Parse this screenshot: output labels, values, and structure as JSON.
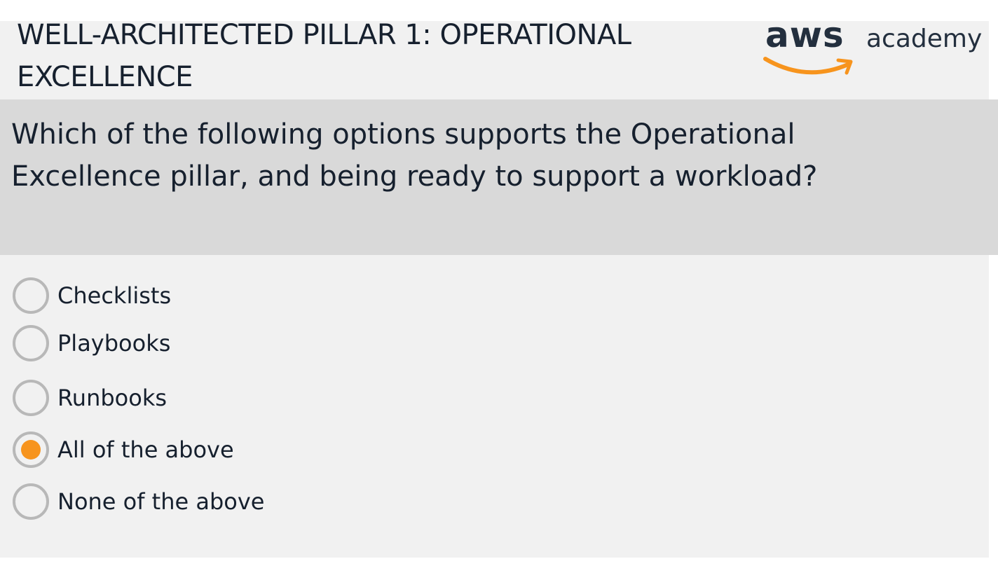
{
  "header": {
    "title": "WELL-ARCHITECTED PILLAR 1: OPERATIONAL EXCELLENCE",
    "logo_primary": "aws",
    "logo_secondary": "academy"
  },
  "question": {
    "text": "Which of the following options supports the Operational Excellence pillar, and being ready to support a workload?"
  },
  "options": [
    {
      "label": "Checklists",
      "selected": false
    },
    {
      "label": "Playbooks",
      "selected": false
    },
    {
      "label": "Runbooks",
      "selected": false
    },
    {
      "label": "All of the above",
      "selected": true
    },
    {
      "label": "None of the above",
      "selected": false
    }
  ],
  "colors": {
    "accent": "#f7941d",
    "text": "#16202e",
    "band": "#d9d9d9",
    "background": "#f1f1f1"
  }
}
